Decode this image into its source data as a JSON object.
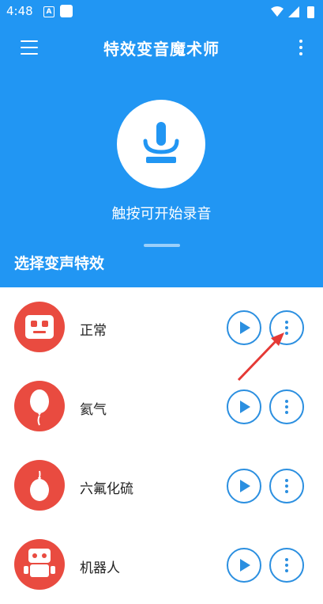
{
  "status_bar": {
    "time": "4:48",
    "notification_a": "A"
  },
  "app_bar": {
    "title": "特效变音魔术师"
  },
  "record": {
    "hint": "触按可开始录音"
  },
  "section": {
    "title": "选择变声特效"
  },
  "effects": [
    {
      "name": "正常",
      "icon": "robot-face-icon"
    },
    {
      "name": "氦气",
      "icon": "balloon-icon"
    },
    {
      "name": "六氟化硫",
      "icon": "heavy-balloon-icon"
    },
    {
      "name": "机器人",
      "icon": "robot-icon"
    }
  ],
  "colors": {
    "primary": "#2196F3",
    "accent_red": "#e94b40",
    "button_outline": "#2b8fe0",
    "annotation_arrow": "#e53935"
  }
}
